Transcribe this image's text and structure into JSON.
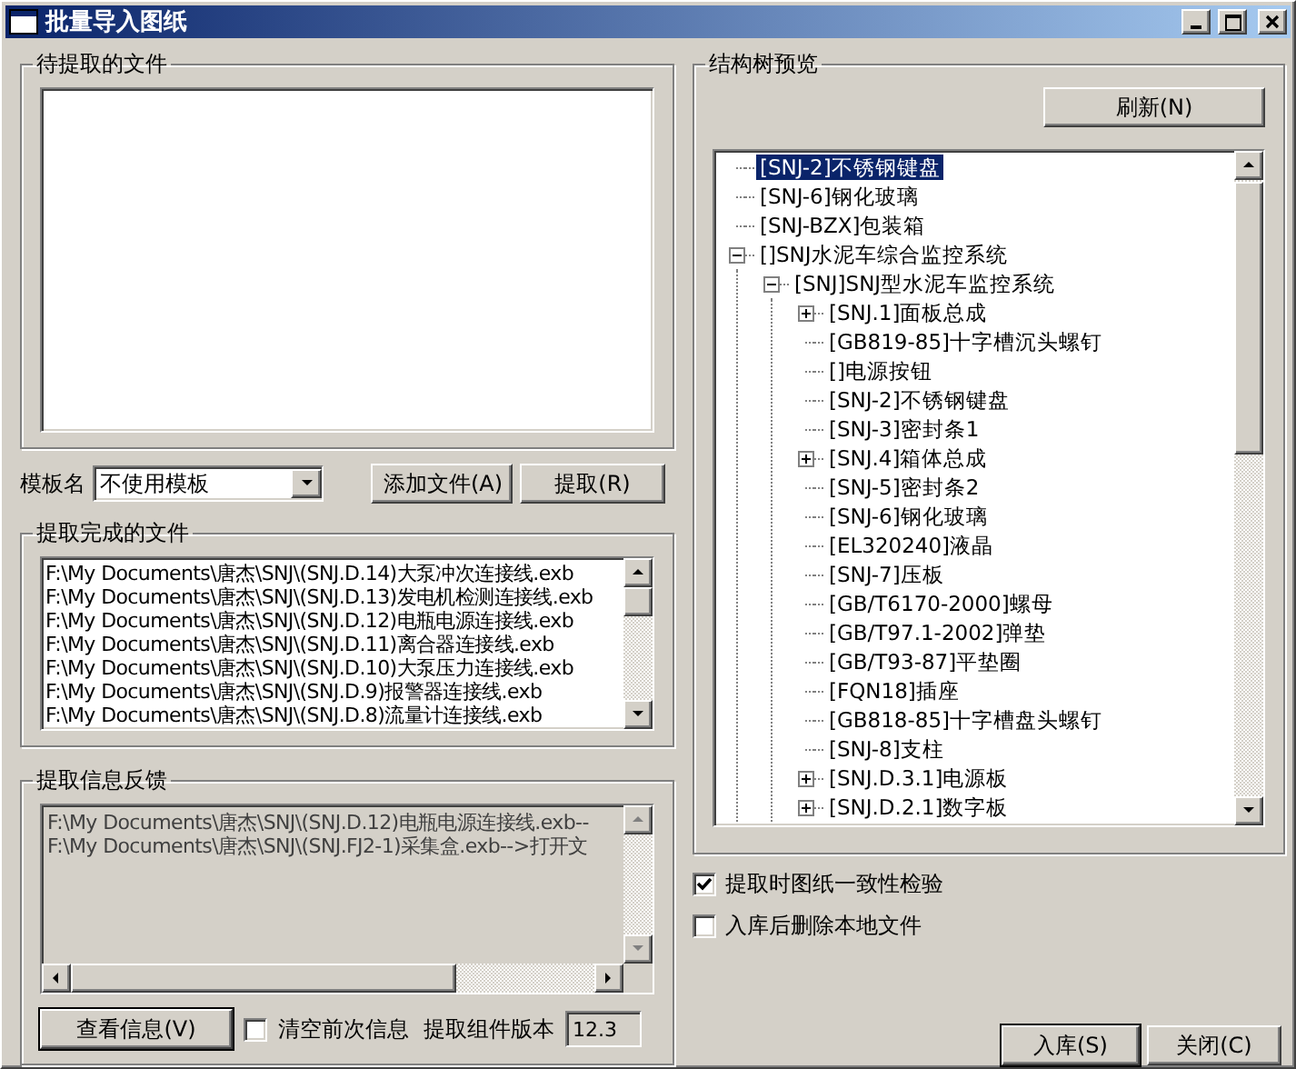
{
  "window": {
    "title": "批量导入图纸"
  },
  "pending_files": {
    "title": "待提取的文件"
  },
  "template": {
    "label": "模板名",
    "value": "不使用模板"
  },
  "file_buttons": [
    "添加文件(A)",
    "提取(R)"
  ],
  "extracted_files": {
    "title": "提取完成的文件",
    "items": [
      "F:\\My Documents\\唐杰\\SNJ\\(SNJ.D.14)大泵冲次连接线.exb",
      "F:\\My Documents\\唐杰\\SNJ\\(SNJ.D.13)发电机检测连接线.exb",
      "F:\\My Documents\\唐杰\\SNJ\\(SNJ.D.12)电瓶电源连接线.exb",
      "F:\\My Documents\\唐杰\\SNJ\\(SNJ.D.11)离合器连接线.exb",
      "F:\\My Documents\\唐杰\\SNJ\\(SNJ.D.10)大泵压力连接线.exb",
      "F:\\My Documents\\唐杰\\SNJ\\(SNJ.D.9)报警器连接线.exb",
      "F:\\My Documents\\唐杰\\SNJ\\(SNJ.D.8)流量计连接线.exb"
    ]
  },
  "feedback": {
    "title": "提取信息反馈",
    "lines": [
      "F:\\My Documents\\唐杰\\SNJ\\(SNJ.D.12)电瓶电源连接线.exb--",
      "F:\\My Documents\\唐杰\\SNJ\\(SNJ.FJ2-1)采集盒.exb-->打开文"
    ],
    "view_button": "查看信息(V)",
    "clear": {
      "label": "清空前次信息",
      "checked": false
    },
    "version_label": "提取组件版本",
    "version": "12.3"
  },
  "tree_preview": {
    "title": "结构树预览",
    "refresh": "刷新(N)",
    "items": [
      {
        "label": "[SNJ-2]不锈钢键盘",
        "kind": "leaf",
        "selected": true
      },
      {
        "label": "[SNJ-6]钢化玻璃",
        "kind": "leaf",
        "selected": false
      },
      {
        "label": "[SNJ-BZX]包装箱",
        "kind": "leaf",
        "selected": false
      },
      {
        "label": "[]SNJ水泥车综合监控系统",
        "kind": "branch",
        "expanded": true,
        "selected": false,
        "children": [
          {
            "label": "[SNJ]SNJ型水泥车监控系统",
            "kind": "branch",
            "expanded": true,
            "selected": false,
            "children": [
              {
                "label": "[SNJ.1]面板总成",
                "kind": "branch",
                "expanded": false,
                "selected": false
              },
              {
                "label": "[GB819-85]十字槽沉头螺钉",
                "kind": "leaf",
                "selected": false
              },
              {
                "label": "[]电源按钮",
                "kind": "leaf",
                "selected": false
              },
              {
                "label": "[SNJ-2]不锈钢键盘",
                "kind": "leaf",
                "selected": false
              },
              {
                "label": "[SNJ-3]密封条1",
                "kind": "leaf",
                "selected": false
              },
              {
                "label": "[SNJ.4]箱体总成",
                "kind": "branch",
                "expanded": false,
                "selected": false
              },
              {
                "label": "[SNJ-5]密封条2",
                "kind": "leaf",
                "selected": false
              },
              {
                "label": "[SNJ-6]钢化玻璃",
                "kind": "leaf",
                "selected": false
              },
              {
                "label": "[EL320240]液晶",
                "kind": "leaf",
                "selected": false
              },
              {
                "label": "[SNJ-7]压板",
                "kind": "leaf",
                "selected": false
              },
              {
                "label": "[GB/T6170-2000]螺母",
                "kind": "leaf",
                "selected": false
              },
              {
                "label": "[GB/T97.1-2002]弹垫",
                "kind": "leaf",
                "selected": false
              },
              {
                "label": "[GB/T93-87]平垫圈",
                "kind": "leaf",
                "selected": false
              },
              {
                "label": "[FQN18]插座",
                "kind": "leaf",
                "selected": false
              },
              {
                "label": "[GB818-85]十字槽盘头螺钉",
                "kind": "leaf",
                "selected": false
              },
              {
                "label": "[SNJ-8]支柱",
                "kind": "leaf",
                "selected": false
              },
              {
                "label": "[SNJ.D.3.1]电源板",
                "kind": "branch",
                "expanded": false,
                "selected": false
              },
              {
                "label": "[SNJ.D.2.1]数字板",
                "kind": "branch",
                "expanded": false,
                "selected": false
              }
            ]
          }
        ]
      }
    ]
  },
  "options": [
    {
      "label": "提取时图纸一致性检验",
      "checked": true
    },
    {
      "label": "入库后删除本地文件",
      "checked": false
    }
  ],
  "buttons": [
    "入库(S)",
    "关闭(C)"
  ]
}
